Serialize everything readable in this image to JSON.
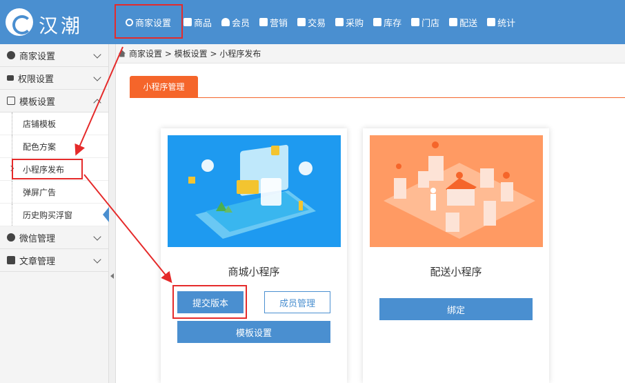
{
  "app": {
    "logo_text": "汉潮"
  },
  "nav": [
    {
      "label": "商家设置",
      "icon": "gear-icon"
    },
    {
      "label": "商品",
      "icon": "database-icon"
    },
    {
      "label": "会员",
      "icon": "user-icon"
    },
    {
      "label": "营销",
      "icon": "megaphone-icon"
    },
    {
      "label": "交易",
      "icon": "document-icon"
    },
    {
      "label": "采购",
      "icon": "cart-icon"
    },
    {
      "label": "库存",
      "icon": "box-icon"
    },
    {
      "label": "门店",
      "icon": "home-icon"
    },
    {
      "label": "配送",
      "icon": "truck-icon"
    },
    {
      "label": "统计",
      "icon": "bar-chart-icon"
    }
  ],
  "sidebar": {
    "groups": [
      {
        "label": "商家设置",
        "icon": "gear-icon"
      },
      {
        "label": "权限设置",
        "icon": "key-icon"
      },
      {
        "label": "模板设置",
        "icon": "template-icon"
      }
    ],
    "sub_items": [
      {
        "label": "店铺模板"
      },
      {
        "label": "配色方案"
      },
      {
        "label": "小程序发布"
      },
      {
        "label": "弹屏广告"
      },
      {
        "label": "历史购买浮窗"
      }
    ],
    "bottom_groups": [
      {
        "label": "微信管理",
        "icon": "wechat-icon"
      },
      {
        "label": "文章管理",
        "icon": "article-icon"
      }
    ]
  },
  "breadcrumb": "商家设置 > 模板设置 > 小程序发布",
  "tab": {
    "label": "小程序管理"
  },
  "cards": [
    {
      "title": "商城小程序",
      "buttons": {
        "submit": "提交版本",
        "members": "成员管理",
        "template": "模板设置"
      }
    },
    {
      "title": "配送小程序",
      "buttons": {
        "bind": "绑定"
      }
    }
  ],
  "colors": {
    "header": "#4a8fd0",
    "accent": "#f5652a",
    "highlight": "#e52a2a"
  }
}
